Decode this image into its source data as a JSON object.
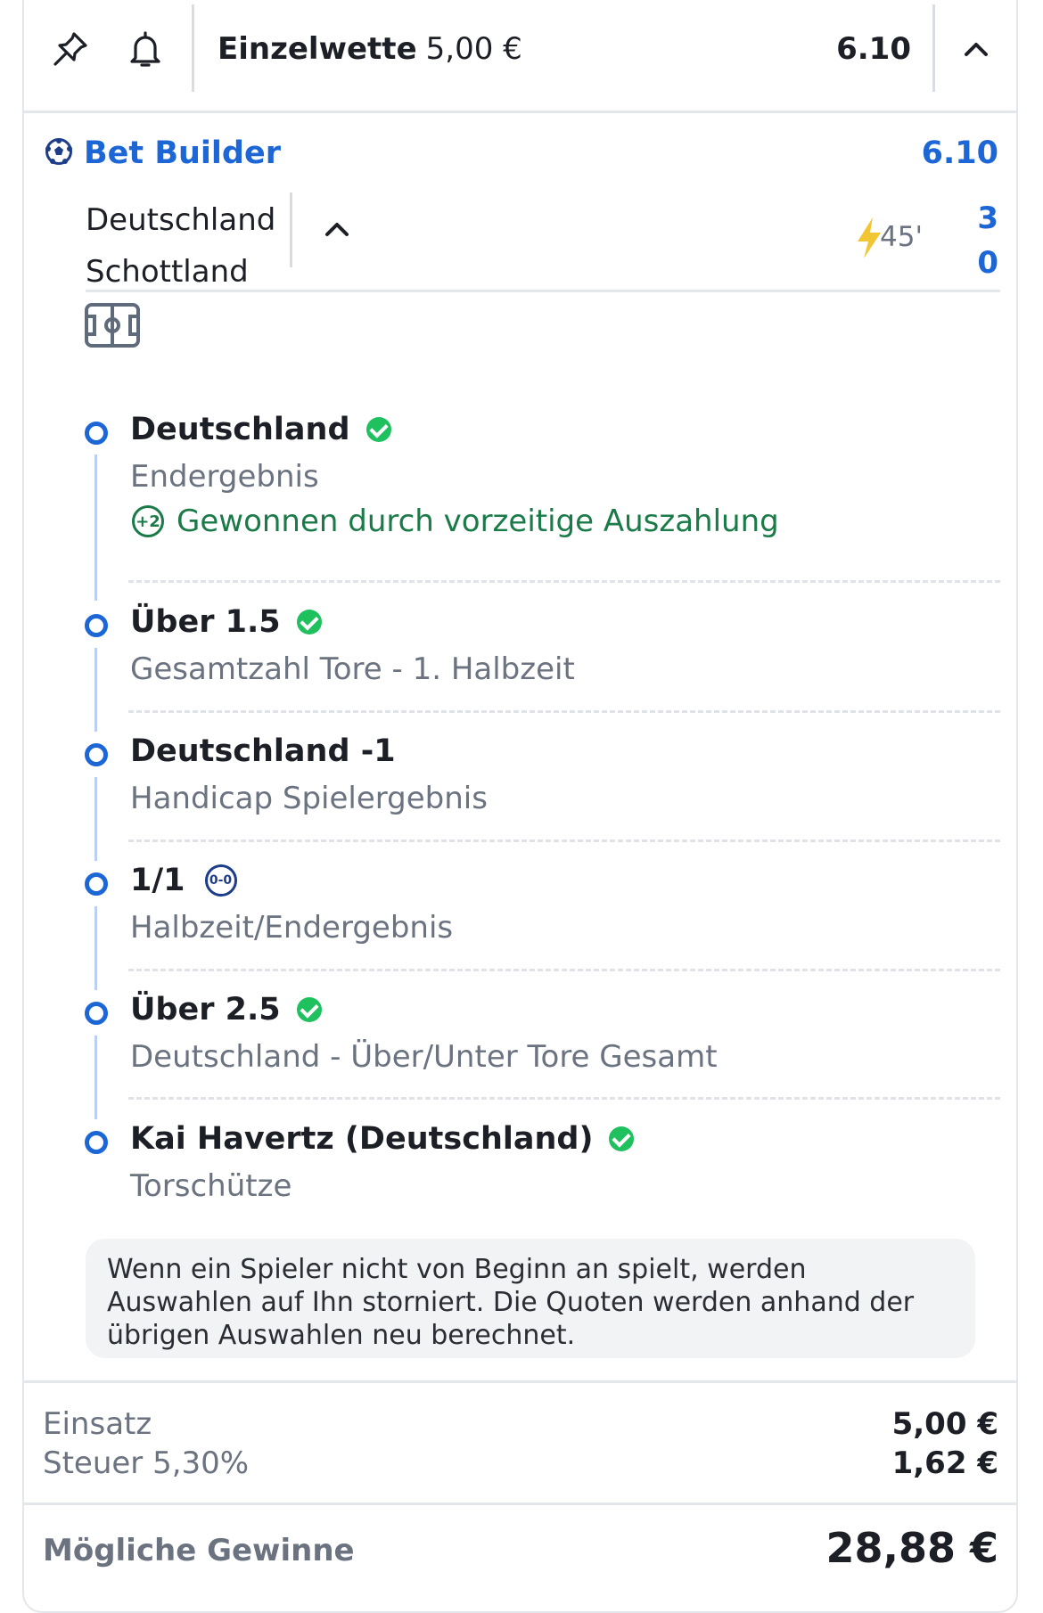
{
  "header": {
    "pin_icon": "pin-icon",
    "bell_icon": "bell-icon",
    "bet_type": "Einzelwette",
    "stake": "5,00 €",
    "odds": "6.10",
    "collapse_icon": "chevron-up-icon"
  },
  "bet_builder": {
    "title": "Bet Builder",
    "odds": "6.10",
    "home_team": "Deutschland",
    "away_team": "Schottland",
    "match_time": "45'",
    "home_score": "3",
    "away_score": "0"
  },
  "legs": [
    {
      "selection": "Deutschland",
      "market": "Endergebnis",
      "status": "won",
      "note": "Gewonnen durch vorzeitige Auszahlung",
      "note_badge": "+2"
    },
    {
      "selection": "Über 1.5",
      "market": "Gesamtzahl Tore - 1. Halbzeit",
      "status": "won"
    },
    {
      "selection": "Deutschland -1",
      "market": "Handicap Spielergebnis",
      "status": "open"
    },
    {
      "selection": "1/1",
      "market": "Halbzeit/Endergebnis",
      "status": "open",
      "badge": "0-0"
    },
    {
      "selection": "Über 2.5",
      "market": "Deutschland - Über/Unter Tore Gesamt",
      "status": "won"
    },
    {
      "selection": "Kai Havertz (Deutschland)",
      "market": "Torschütze",
      "status": "won"
    }
  ],
  "info_text": "Wenn ein Spieler nicht von Beginn an spielt, werden Auswahlen auf Ihn storniert. Die Quoten werden anhand der übrigen Auswahlen neu berechnet.",
  "summary": {
    "stake_label": "Einsatz",
    "stake_value": "5,00 €",
    "tax_label": "Steuer 5,30%",
    "tax_value": "1,62 €",
    "winnings_label": "Mögliche Gewinne",
    "winnings_value": "28,88 €"
  },
  "colors": {
    "accent": "#1c66d6",
    "win_green": "#1fc15f",
    "note_green": "#1a7a48",
    "muted": "#6b7280"
  }
}
